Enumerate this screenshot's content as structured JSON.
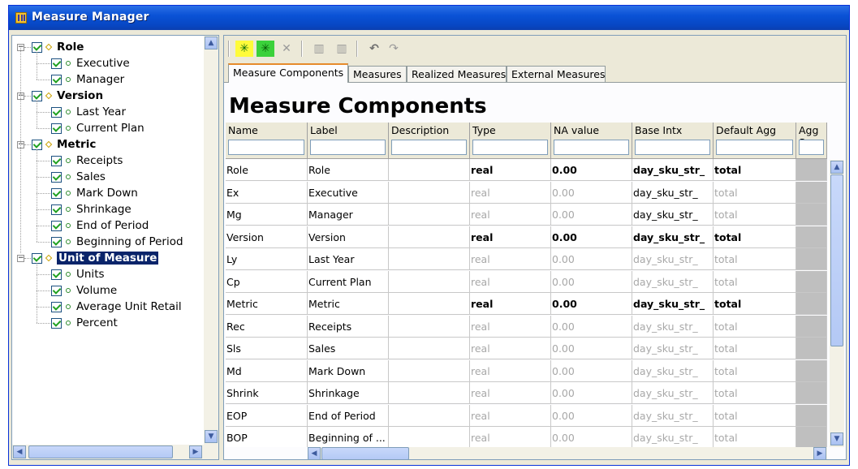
{
  "window": {
    "title": "Measure Manager"
  },
  "tree": {
    "groups": [
      {
        "label": "Role",
        "children": [
          "Executive",
          "Manager"
        ]
      },
      {
        "label": "Version",
        "children": [
          "Last Year",
          "Current Plan"
        ]
      },
      {
        "label": "Metric",
        "children": [
          "Receipts",
          "Sales",
          "Mark Down",
          "Shrinkage",
          "End of Period",
          "Beginning of Period"
        ]
      },
      {
        "label": "Unit of Measure",
        "children": [
          "Units",
          "Volume",
          "Average Unit Retail",
          "Percent"
        ],
        "selected": true
      }
    ],
    "expander_symbol": "−"
  },
  "toolbar": {
    "icons": [
      "add-measure-yellow-icon",
      "add-measure-green-icon",
      "delete-icon",
      "column-icon-1",
      "column-icon-2",
      "undo-icon",
      "redo-icon"
    ],
    "add_glyph": "✳",
    "delete_glyph": "✕",
    "col_glyph": "▥",
    "undo_glyph": "↶",
    "redo_glyph": "↷"
  },
  "tabs": [
    "Measure Components",
    "Measures",
    "Realized Measures",
    "External Measures"
  ],
  "active_tab": 0,
  "page_title": "Measure Components",
  "table": {
    "columns": [
      "Name",
      "Label",
      "Description",
      "Type",
      "NA value",
      "Base Intx",
      "Default Agg",
      "Agg S"
    ],
    "rows": [
      {
        "name": "Role",
        "label": "Role",
        "description": "",
        "type": "real",
        "na": "0.00",
        "base": "day_sku_str_",
        "agg": "total",
        "bold": true
      },
      {
        "name": "Ex",
        "label": "Executive",
        "description": "",
        "type": "real",
        "na": "0.00",
        "base": "day_sku_str_",
        "agg": "total",
        "bold": false,
        "base_black": true
      },
      {
        "name": "Mg",
        "label": "Manager",
        "description": "",
        "type": "real",
        "na": "0.00",
        "base": "day_sku_str_",
        "agg": "total",
        "bold": false,
        "base_black": true
      },
      {
        "name": "Version",
        "label": "Version",
        "description": "",
        "type": "real",
        "na": "0.00",
        "base": "day_sku_str_",
        "agg": "total",
        "bold": true
      },
      {
        "name": "Ly",
        "label": "Last Year",
        "description": "",
        "type": "real",
        "na": "0.00",
        "base": "day_sku_str_",
        "agg": "total",
        "bold": false
      },
      {
        "name": "Cp",
        "label": "Current Plan",
        "description": "",
        "type": "real",
        "na": "0.00",
        "base": "day_sku_str_",
        "agg": "total",
        "bold": false
      },
      {
        "name": "Metric",
        "label": "Metric",
        "description": "",
        "type": "real",
        "na": "0.00",
        "base": "day_sku_str_",
        "agg": "total",
        "bold": true
      },
      {
        "name": "Rec",
        "label": "Receipts",
        "description": "",
        "type": "real",
        "na": "0.00",
        "base": "day_sku_str_",
        "agg": "total",
        "bold": false
      },
      {
        "name": "Sls",
        "label": "Sales",
        "description": "",
        "type": "real",
        "na": "0.00",
        "base": "day_sku_str_",
        "agg": "total",
        "bold": false
      },
      {
        "name": "Md",
        "label": "Mark Down",
        "description": "",
        "type": "real",
        "na": "0.00",
        "base": "day_sku_str_",
        "agg": "total",
        "bold": false
      },
      {
        "name": "Shrink",
        "label": "Shrinkage",
        "description": "",
        "type": "real",
        "na": "0.00",
        "base": "day_sku_str_",
        "agg": "total",
        "bold": false
      },
      {
        "name": "EOP",
        "label": "End of Period",
        "description": "",
        "type": "real",
        "na": "0.00",
        "base": "day_sku_str_",
        "agg": "total",
        "bold": false
      },
      {
        "name": "BOP",
        "label": "Beginning of ...",
        "description": "",
        "type": "real",
        "na": "0.00",
        "base": "day_sku_str_",
        "agg": "total",
        "bold": false
      }
    ]
  },
  "scroll": {
    "up": "▲",
    "down": "▼",
    "left": "◀",
    "right": "▶"
  },
  "colors": {
    "title_bar": "#0a52d6",
    "selection": "#0a246a",
    "tab_highlight": "#e68b2c",
    "agg_column": "#bfbfbf"
  }
}
